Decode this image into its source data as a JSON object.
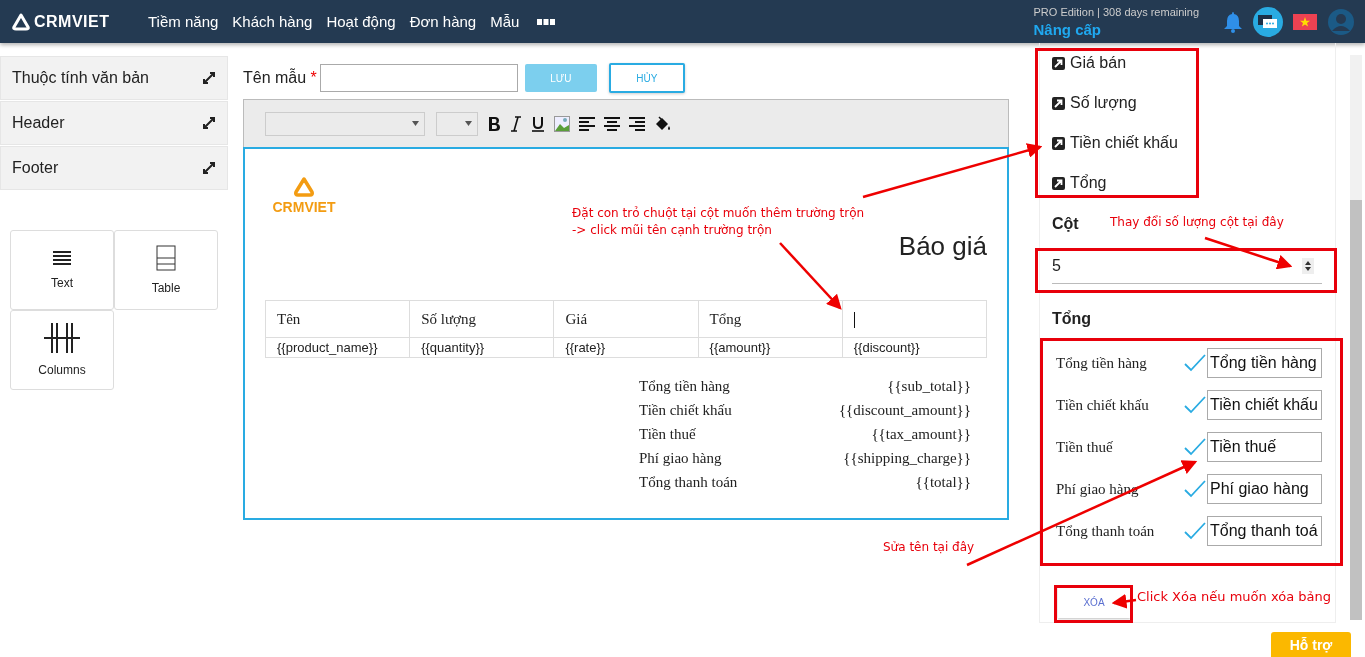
{
  "nav": {
    "logo": "CRMVIET",
    "menu": [
      "Tiềm năng",
      "Khách hàng",
      "Hoạt động",
      "Đơn hàng",
      "Mẫu"
    ],
    "edition": "PRO Edition | 308 days remaining",
    "upgrade": "Nâng cấp"
  },
  "sidebar": {
    "panels": [
      "Thuộc tính văn bản",
      "Header",
      "Footer"
    ],
    "widgets": [
      {
        "label": "Text",
        "kind": "text"
      },
      {
        "label": "Table",
        "kind": "table"
      },
      {
        "label": "Columns",
        "kind": "columns"
      }
    ]
  },
  "form": {
    "label": "Tên mẫu",
    "required": "*",
    "save": "LƯU",
    "cancel": "HỦY"
  },
  "editor": {
    "logo": "CRMVIET",
    "title": "Báo giá",
    "columns": [
      {
        "header": "Tên",
        "field": "{{product_name}}",
        "cursor": false
      },
      {
        "header": "Số lượng",
        "field": "{{quantity}}",
        "cursor": false
      },
      {
        "header": "Giá",
        "field": "{{rate}}",
        "cursor": false
      },
      {
        "header": "Tổng",
        "field": "{{amount}}",
        "cursor": false
      },
      {
        "field": "{{discount}}",
        "cursor": true
      }
    ],
    "totals": [
      {
        "label": "Tổng tiền hàng",
        "value": "{{sub_total}}"
      },
      {
        "label": "Tiền chiết khấu",
        "value": "{{discount_amount}}"
      },
      {
        "label": "Tiền thuế",
        "value": "{{tax_amount}}"
      },
      {
        "label": "Phí giao hàng",
        "value": "{{shipping_charge}}"
      },
      {
        "label": "Tổng thanh toán",
        "value": "{{total}}"
      }
    ]
  },
  "panel": {
    "merge_fields": [
      "Giá bán",
      "Số lượng",
      "Tiền chiết khấu",
      "Tổng"
    ],
    "columns_label": "Cột",
    "columns_value": "5",
    "totals_label": "Tổng",
    "total_rows": [
      {
        "label": "Tổng tiền hàng",
        "value": "Tổng tiền hàng",
        "checked": true
      },
      {
        "label": "Tiền chiết khấu",
        "value": "Tiền chiết khấu",
        "checked": true
      },
      {
        "label": "Tiền thuế",
        "value": "Tiền thuế",
        "checked": true
      },
      {
        "label": "Phí giao hàng",
        "value": "Phí giao hàng",
        "checked": true
      },
      {
        "label": "Tổng thanh toán",
        "value": "Tổng thanh toá",
        "checked": true
      }
    ],
    "delete": "XÓA"
  },
  "support": "Hỗ trợ",
  "notes": {
    "cursor": [
      "Đặt con trỏ chuột tại cột muốn thêm trường trộn",
      "-> click mũi tên cạnh trường trộn"
    ],
    "columns": "Thay đổi số lượng cột tại đây",
    "rename": "Sửa tên tại đây",
    "delete": "Click Xóa nếu muốn xóa bảng"
  }
}
